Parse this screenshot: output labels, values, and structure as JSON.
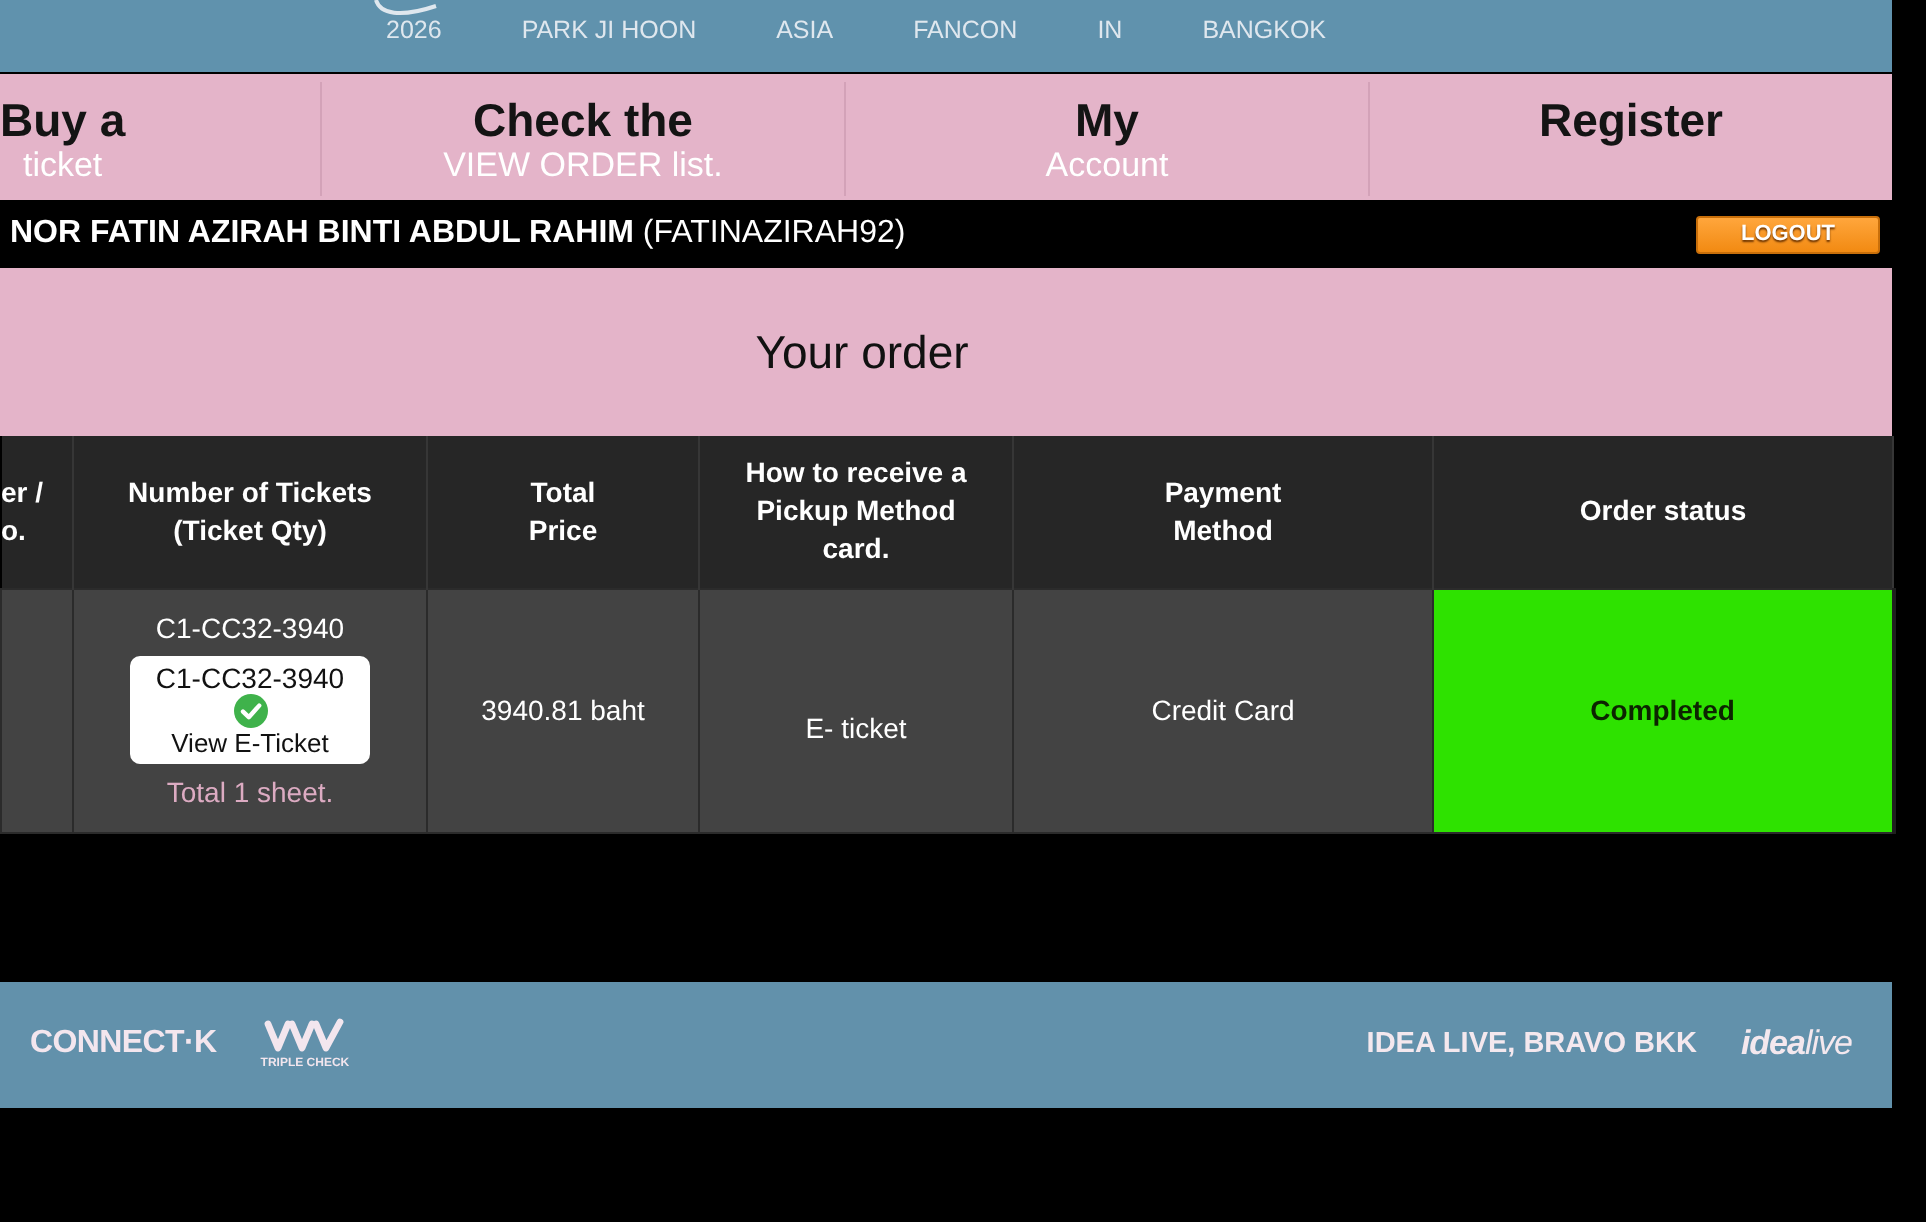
{
  "banner": {
    "year": "2026",
    "words": [
      "PARK JI HOON",
      "ASIA",
      "FANCON",
      "IN",
      "BANGKOK"
    ]
  },
  "nav": {
    "items": [
      {
        "title": "Buy a",
        "subtitle": "ticket"
      },
      {
        "title": "Check the",
        "subtitle": "VIEW ORDER list."
      },
      {
        "title": "My",
        "subtitle": "Account"
      },
      {
        "title": "Register"
      }
    ]
  },
  "user_bar": {
    "user": "**NOR FATIN AZIRAH BINTI ABDUL RAHIM** (FATINAZIRAH92)",
    "logout_button": "LOGOUT"
  },
  "page_title": "Your order",
  "table": {
    "columns": [
      "er /\no.",
      "Number of Tickets\n(Ticket Qty)",
      "Total\nPrice",
      "How to receive a\nPickup Method\ncard.",
      "Payment\nMethod",
      "Order status"
    ],
    "rows": [
      {
        "tickets": {
          "code": "C1-CC32-3940",
          "e_ticket": {
            "code": "C1-CC32-3940",
            "link": "View E-Ticket"
          },
          "total": "Total 1 sheet."
        },
        "total_price": "3940.81 baht",
        "pickup_method": "E- ticket",
        "payment_method": "Credit Card",
        "order_status": {
          "label": "Completed",
          "kind": "completed"
        }
      }
    ]
  },
  "footer": {
    "connect_logo": "CONNECT·K",
    "triple_check_logo": "TRIPLE CHECK",
    "credits": "IDEA LIVE, BRAVO BKK",
    "brand": "**idea**live"
  }
}
